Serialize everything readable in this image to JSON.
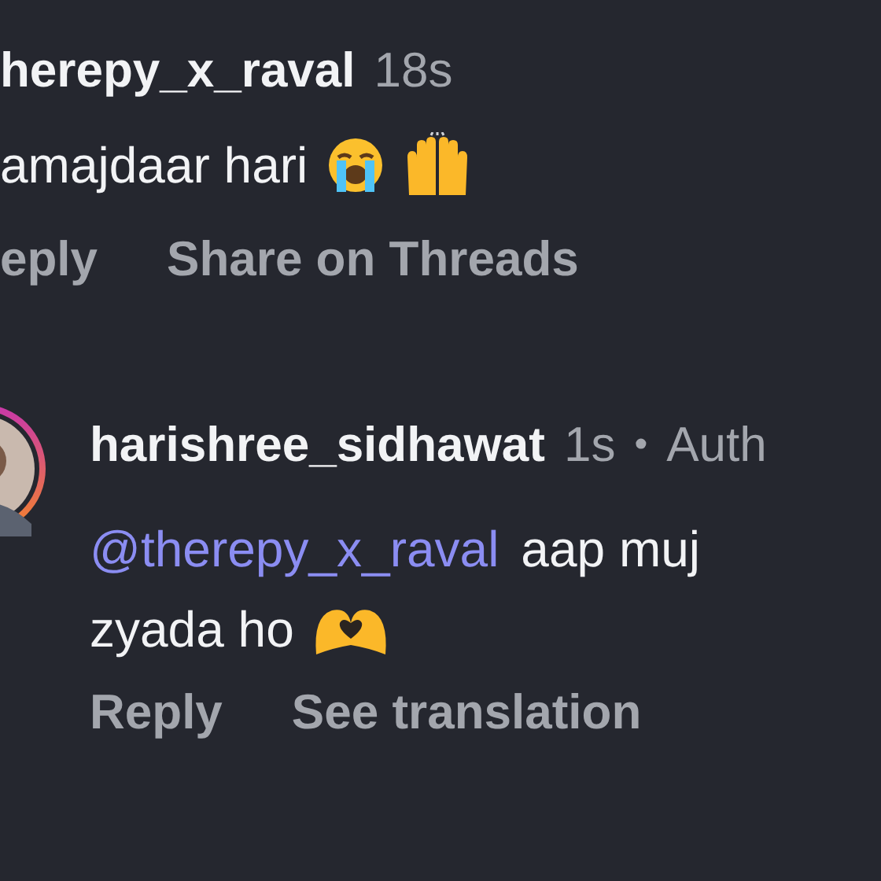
{
  "comments": [
    {
      "username": "herepy_x_raval",
      "time": "18s",
      "text": "amajdaar hari",
      "emojis": [
        {
          "kind": "crying"
        },
        {
          "kind": "raised-hands"
        }
      ],
      "actions": [
        "eply",
        "Share on Threads"
      ]
    },
    {
      "username": "harishree_sidhawat",
      "time": "1s",
      "separator": "•",
      "badge": "Auth",
      "avatar": true,
      "mention": "@therepy_x_raval",
      "lines": [
        "aap muj",
        "zyada ho"
      ],
      "emojis": [
        {
          "kind": "heart-hands"
        }
      ],
      "actions": [
        "Reply",
        "See translation"
      ]
    }
  ]
}
